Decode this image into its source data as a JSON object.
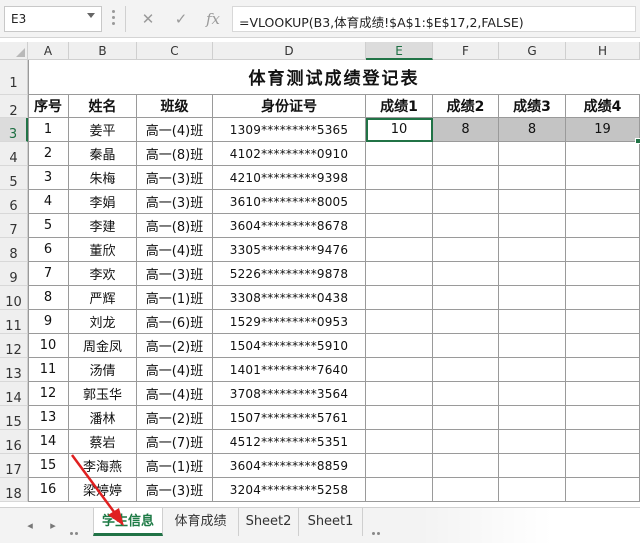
{
  "formula_bar": {
    "name_box": "E3",
    "cancel_icon": "✕",
    "enter_icon": "✓",
    "fx_label": "fx",
    "formula": "=VLOOKUP(B3,体育成绩!$A$1:$E$17,2,FALSE)"
  },
  "columns": [
    "A",
    "B",
    "C",
    "D",
    "E",
    "F",
    "G",
    "H"
  ],
  "rows": [
    "1",
    "2",
    "3",
    "4",
    "5",
    "6",
    "7",
    "8",
    "9",
    "10",
    "11",
    "12",
    "13",
    "14",
    "15",
    "16",
    "17",
    "18"
  ],
  "sheet": {
    "title": "体育测试成绩登记表",
    "headers": [
      "序号",
      "姓名",
      "班级",
      "身份证号",
      "成绩1",
      "成绩2",
      "成绩3",
      "成绩4"
    ],
    "records": [
      [
        "1",
        "姜平",
        "高一(4)班",
        "1309*********5365",
        "10",
        "8",
        "8",
        "19"
      ],
      [
        "2",
        "秦晶",
        "高一(8)班",
        "4102*********0910",
        "",
        "",
        "",
        ""
      ],
      [
        "3",
        "朱梅",
        "高一(3)班",
        "4210*********9398",
        "",
        "",
        "",
        ""
      ],
      [
        "4",
        "李娟",
        "高一(3)班",
        "3610*********8005",
        "",
        "",
        "",
        ""
      ],
      [
        "5",
        "李建",
        "高一(8)班",
        "3604*********8678",
        "",
        "",
        "",
        ""
      ],
      [
        "6",
        "董欣",
        "高一(4)班",
        "3305*********9476",
        "",
        "",
        "",
        ""
      ],
      [
        "7",
        "李欢",
        "高一(3)班",
        "5226*********9878",
        "",
        "",
        "",
        ""
      ],
      [
        "8",
        "严辉",
        "高一(1)班",
        "3308*********0438",
        "",
        "",
        "",
        ""
      ],
      [
        "9",
        "刘龙",
        "高一(6)班",
        "1529*********0953",
        "",
        "",
        "",
        ""
      ],
      [
        "10",
        "周金凤",
        "高一(2)班",
        "1504*********5910",
        "",
        "",
        "",
        ""
      ],
      [
        "11",
        "汤倩",
        "高一(4)班",
        "1401*********7640",
        "",
        "",
        "",
        ""
      ],
      [
        "12",
        "郭玉华",
        "高一(4)班",
        "3708*********3564",
        "",
        "",
        "",
        ""
      ],
      [
        "13",
        "潘林",
        "高一(2)班",
        "1507*********5761",
        "",
        "",
        "",
        ""
      ],
      [
        "14",
        "蔡岩",
        "高一(7)班",
        "4512*********5351",
        "",
        "",
        "",
        ""
      ],
      [
        "15",
        "李海燕",
        "高一(1)班",
        "3604*********8859",
        "",
        "",
        "",
        ""
      ],
      [
        "16",
        "梁婷婷",
        "高一(3)班",
        "3204*********5258",
        "",
        "",
        "",
        ""
      ]
    ]
  },
  "selection": {
    "active_cell": "E3",
    "highlight_color": "#c4c4c4",
    "accent": "#217346",
    "annotation_color": "#e02020"
  },
  "tabs": {
    "nav_prev": "◂",
    "nav_next": "▸",
    "items": [
      "学生信息",
      "体育成绩",
      "Sheet2",
      "Sheet1"
    ],
    "active": "学生信息"
  }
}
